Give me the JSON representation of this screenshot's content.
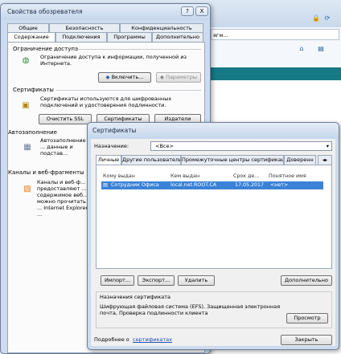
{
  "ie_options": {
    "title": "Свойства обозревателя",
    "tabs_row1": [
      "Общие",
      "Безопасность",
      "Конфиденциальность"
    ],
    "tabs_row2": [
      "Содержание",
      "Подключения",
      "Программы",
      "Дополнительно"
    ],
    "content_advisor": {
      "heading": "Ограничение доступа",
      "text": "Ограничение доступа к информации, полученной из Интернета.",
      "enable_btn": "Включить...",
      "settings_btn": "Параметры"
    },
    "certificates": {
      "heading": "Сертификаты",
      "text": "Сертификаты используются для шифрованных подключений и удостоверения подлинности.",
      "clear_ssl_btn": "Очистить SSL",
      "certs_btn": "Сертификаты",
      "publishers_btn": "Издатели"
    },
    "autocomplete": {
      "heading": "Автозаполнение",
      "text": "Автозаполнение ... данные и подстав..."
    },
    "feeds": {
      "heading": "Каналы и веб-фрагменты",
      "text": "Каналы и веб-ф... предоставляют ... содержимое веб... можно прочитать ... Internet Explorer ..."
    }
  },
  "browser": {
    "menu_fragment": "ягм...",
    "caption_buttons": [
      "?",
      "X"
    ]
  },
  "cert_dialog": {
    "title": "Сертификаты",
    "purpose_label": "Назначение:",
    "purpose_value": "<Все>",
    "tabs": [
      "Личные",
      "Другие пользователи",
      "Промежуточные центры сертификации",
      "Доверенн"
    ],
    "columns": [
      "Кому выдан",
      "Кем выдан",
      "Срок де...",
      "Понятное имя"
    ],
    "rows": [
      {
        "to": "Сотрудник Офиса",
        "by": "local.net.ROOT.CA",
        "exp": "17.05.2017",
        "name": "<нет>"
      }
    ],
    "buttons": {
      "import": "Импорт...",
      "export": "Экспорт...",
      "remove": "Удалить",
      "advanced": "Дополнительно",
      "view": "Просмотр",
      "close": "Закрыть"
    },
    "purposes_heading": "Назначения сертификата",
    "purposes_text": "Шифрующая файловая система (EFS), Защищенная электронная почта, Проверка подлинности клиента",
    "more_prefix": "Подробнее о",
    "more_link": "сертификатах"
  },
  "colors": {
    "selection": "#3b82d6",
    "link": "#1f4fb0",
    "accent_strip": "#157a86"
  }
}
